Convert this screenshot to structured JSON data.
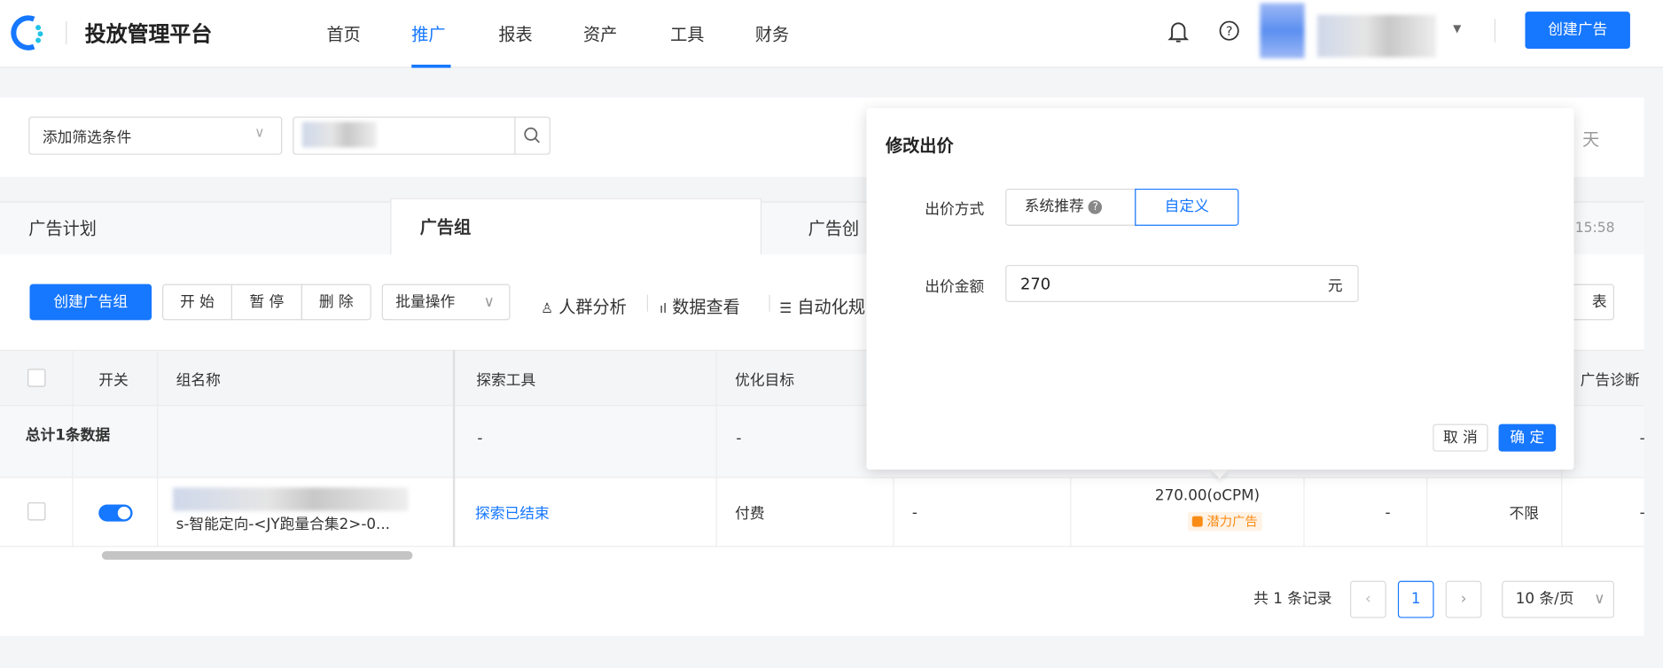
{
  "header": {
    "title": "投放管理平台",
    "nav": [
      "首页",
      "推广",
      "报表",
      "资产",
      "工具",
      "财务"
    ],
    "active_nav": 1,
    "create_ad": "创建广告"
  },
  "filter": {
    "select_placeholder": "添加筛选条件",
    "right_text": "天"
  },
  "tabs": {
    "items": [
      "广告计划",
      "广告组",
      "广告创"
    ],
    "active": 1,
    "time": "15:58"
  },
  "toolbar": {
    "create_group": "创建广告组",
    "start": "开 始",
    "pause": "暂 停",
    "delete": "删 除",
    "batch": "批量操作",
    "audience": "人群分析",
    "data_view": "数据查看",
    "auto_rule": "自动化规",
    "right_btn": "表"
  },
  "table": {
    "headers": [
      "开关",
      "组名称",
      "探索工具",
      "优化目标",
      "广告诊断"
    ],
    "summary": {
      "label": "总计1条数据",
      "values": [
        "-",
        "-",
        "-"
      ]
    },
    "row": {
      "name": "s-智能定向-<JY跑量合集2>-0...",
      "explore": "探索已结束",
      "goal": "付费",
      "col6": "-",
      "bid": "270.00(oCPM)",
      "badge": "潜力广告",
      "col8": "-",
      "limit": "不限",
      "col10": "-",
      "switch_on": true
    }
  },
  "pagination": {
    "total": "共 1 条记录",
    "page": "1",
    "page_size": "10 条/页"
  },
  "popover": {
    "title": "修改出价",
    "method_label": "出价方式",
    "method_options": [
      "系统推荐",
      "自定义"
    ],
    "method_selected": 1,
    "amount_label": "出价金额",
    "amount_value": "270",
    "amount_unit": "元",
    "cancel": "取 消",
    "confirm": "确 定"
  },
  "colors": {
    "primary": "#1677ff",
    "badge": "#fa8c16"
  }
}
